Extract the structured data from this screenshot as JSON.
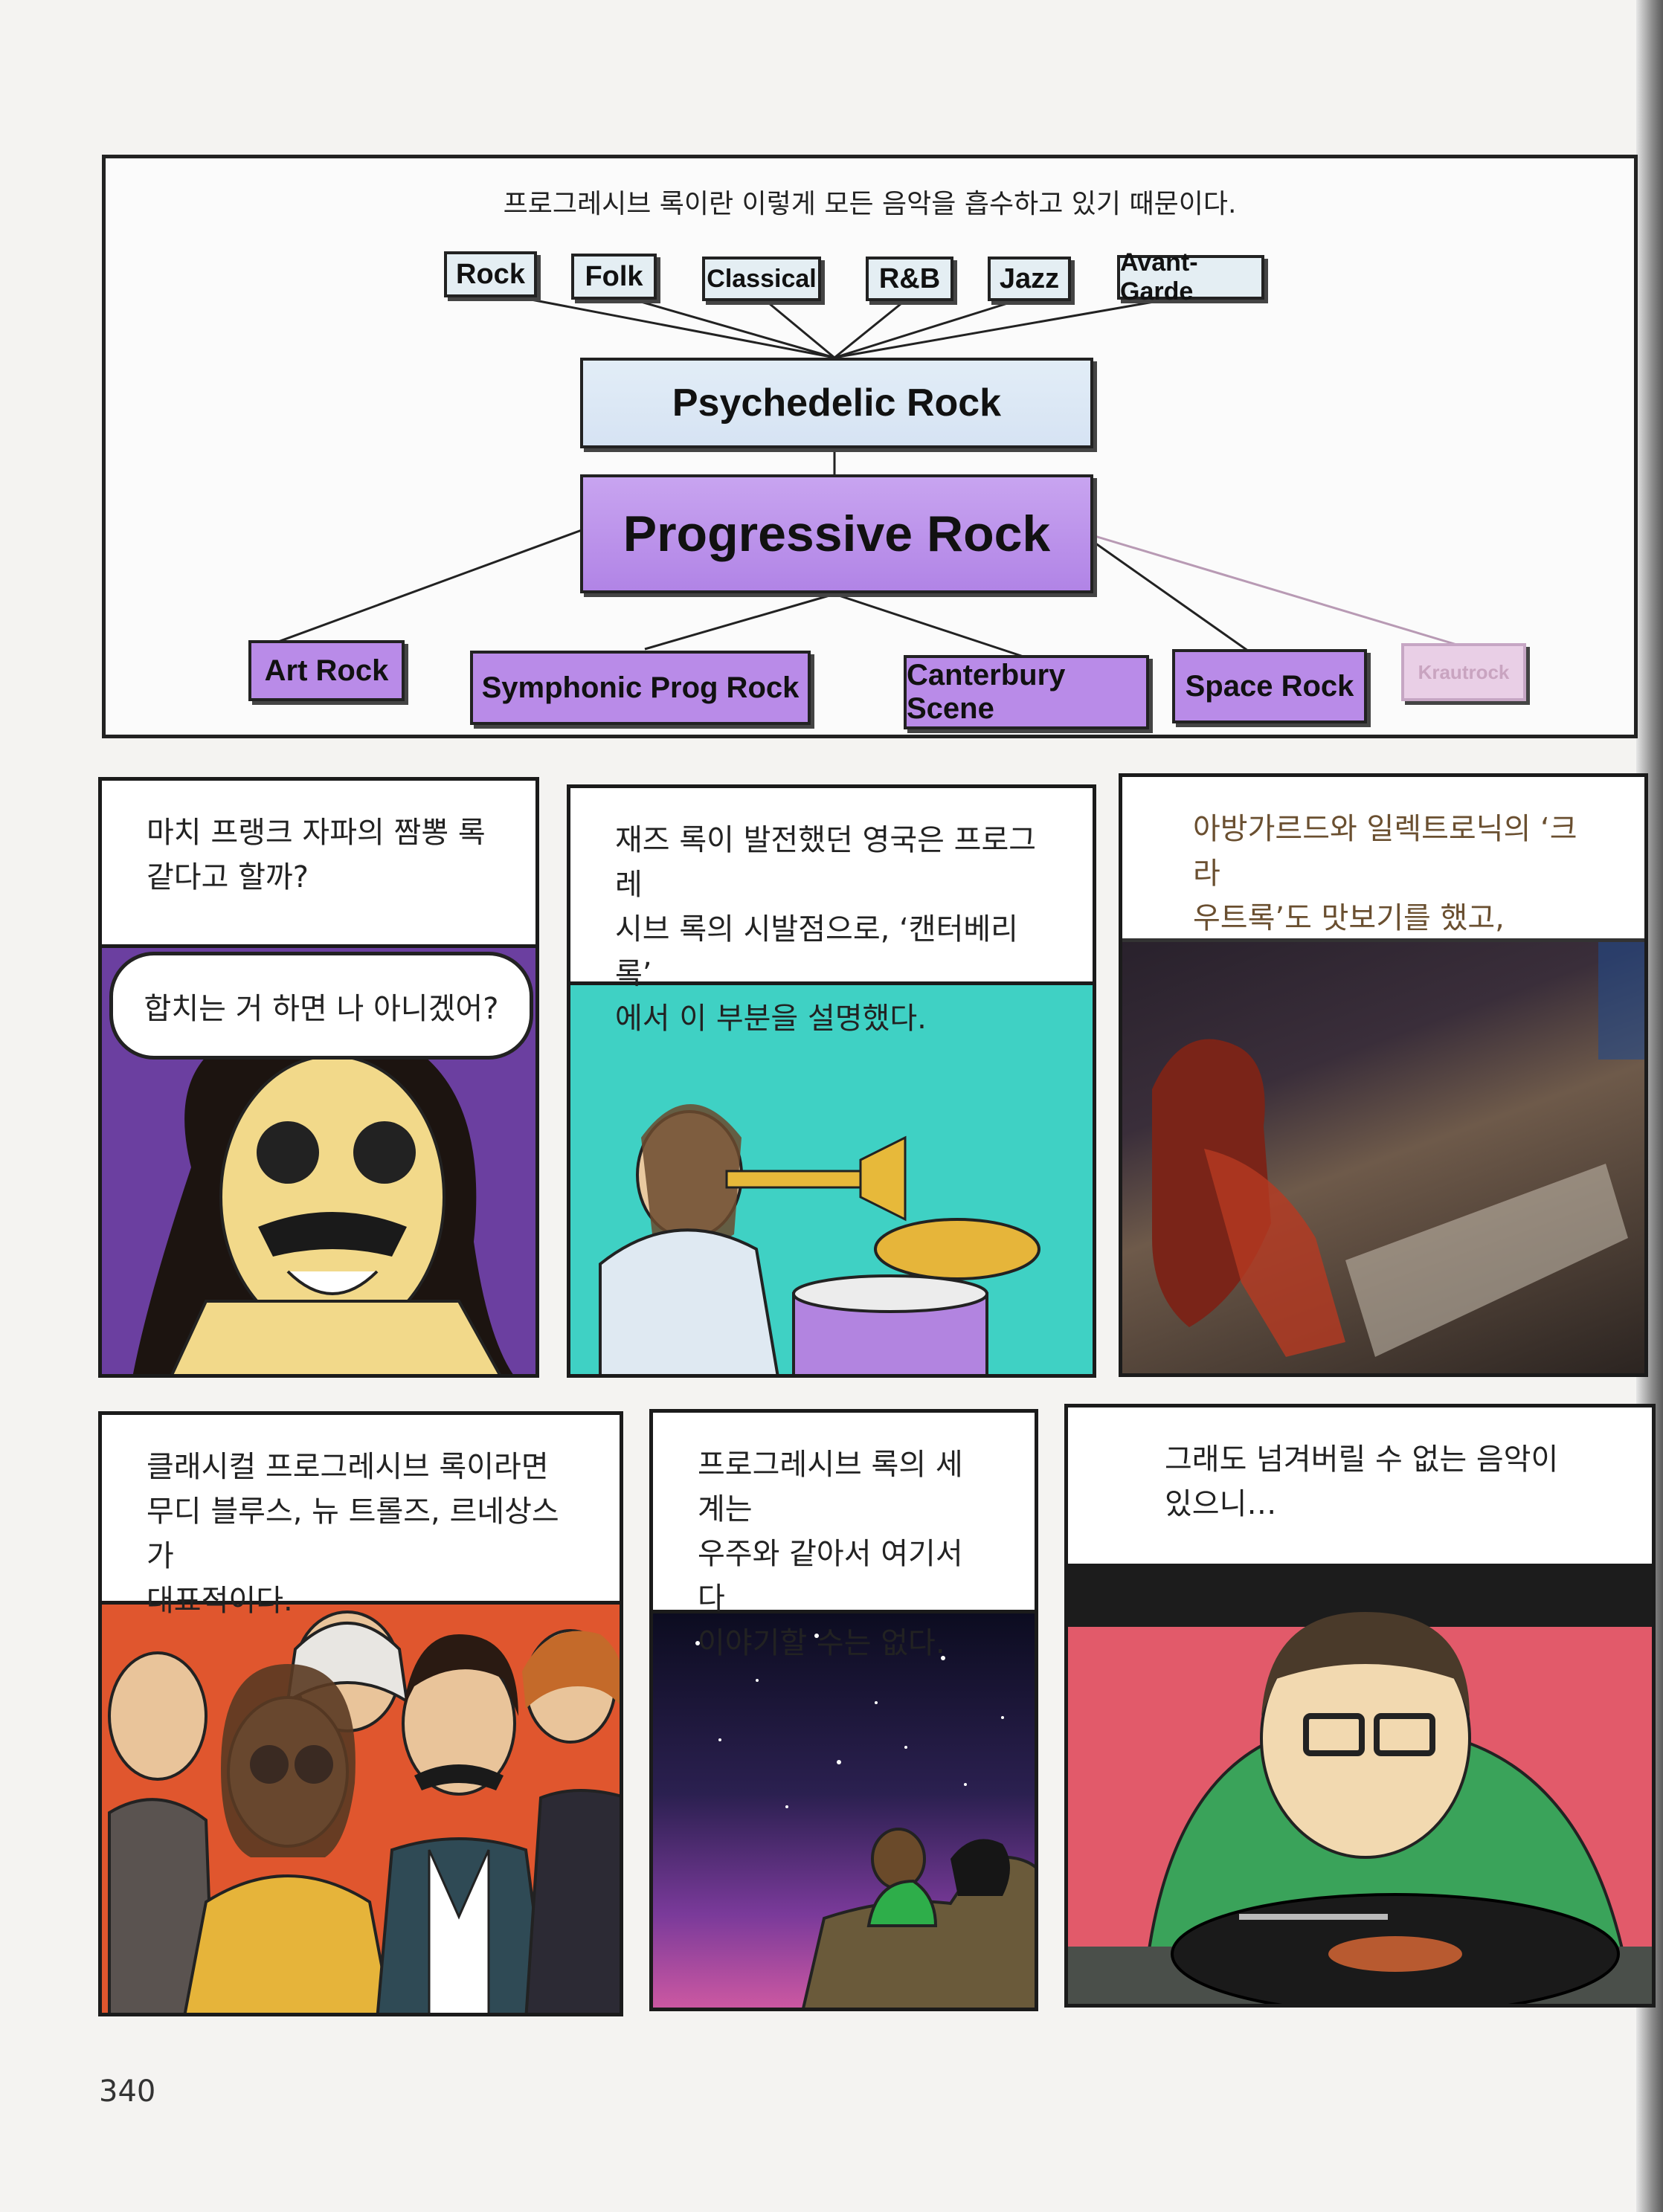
{
  "diagram": {
    "caption": "프로그레시브 록이란 이렇게 모든 음악을 흡수하고 있기 때문이다.",
    "sources": [
      "Rock",
      "Folk",
      "Classical",
      "R&B",
      "Jazz",
      "Avant-Garde"
    ],
    "middle": "Psychedelic Rock",
    "center": "Progressive Rock",
    "subgenres": [
      "Art Rock",
      "Symphonic Prog Rock",
      "Canterbury Scene",
      "Space Rock",
      "Krautrock"
    ]
  },
  "panels": {
    "p1_caption": [
      "마치 프랭크 자파의 짬뽕 록",
      "같다고 할까?"
    ],
    "p1_bubble": "합치는 거 하면 나 아니겠어?",
    "p2_caption": [
      "재즈 록이 발전했던 영국은 프로그레",
      "시브 록의 시발점으로, ‘캔터베리 록’",
      "에서 이 부분을 설명했다."
    ],
    "p3_caption": [
      "아방가르드와 일렉트로닉의 ‘크라",
      "우트록’도 맛보기를 했고,"
    ],
    "p4_caption": [
      "클래시컬 프로그레시브 록이라면",
      "무디 블루스, 뉴 트롤즈, 르네상스가",
      "대표적이다."
    ],
    "p5_caption": [
      "프로그레시브 록의 세계는",
      "우주와 같아서 여기서 다",
      "이야기할 수는 없다."
    ],
    "p6_caption": [
      "그래도 넘겨버릴 수 없는 음악이",
      "있으니…"
    ]
  },
  "page_number": "340",
  "colors": {
    "prog_purple": "#b184e6",
    "sky_blue": "#e2edf7",
    "teal": "#3fd1c4",
    "violet": "#6b3fa0"
  }
}
